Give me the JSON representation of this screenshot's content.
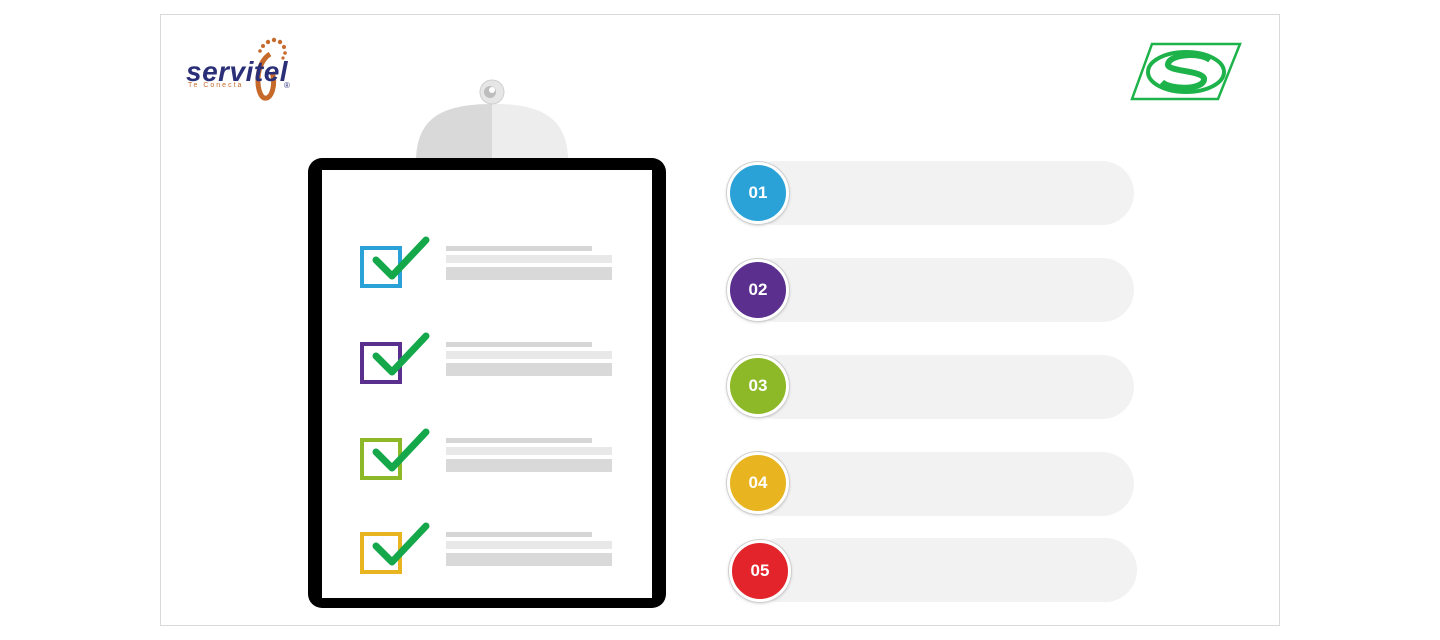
{
  "logos": {
    "left": {
      "name": "servitel",
      "word": "servitel",
      "tagline": "Te Conecta",
      "word_color": "#2b2f77",
      "accent_color": "#c66a2b"
    },
    "right": {
      "name": "S-logo",
      "color": "#1db34a"
    }
  },
  "checklist": {
    "board_color": "#000000",
    "tick_color": "#14a84b",
    "items": [
      {
        "box_color": "#2aa2d8"
      },
      {
        "box_color": "#5b2f8e"
      },
      {
        "box_color": "#8db827"
      },
      {
        "box_color": "#e8b420"
      }
    ]
  },
  "steps": [
    {
      "number": "01",
      "color": "#2aa2d8"
    },
    {
      "number": "02",
      "color": "#5b2f8e"
    },
    {
      "number": "03",
      "color": "#8db827"
    },
    {
      "number": "04",
      "color": "#e8b420"
    },
    {
      "number": "05",
      "color": "#e3242b"
    }
  ]
}
